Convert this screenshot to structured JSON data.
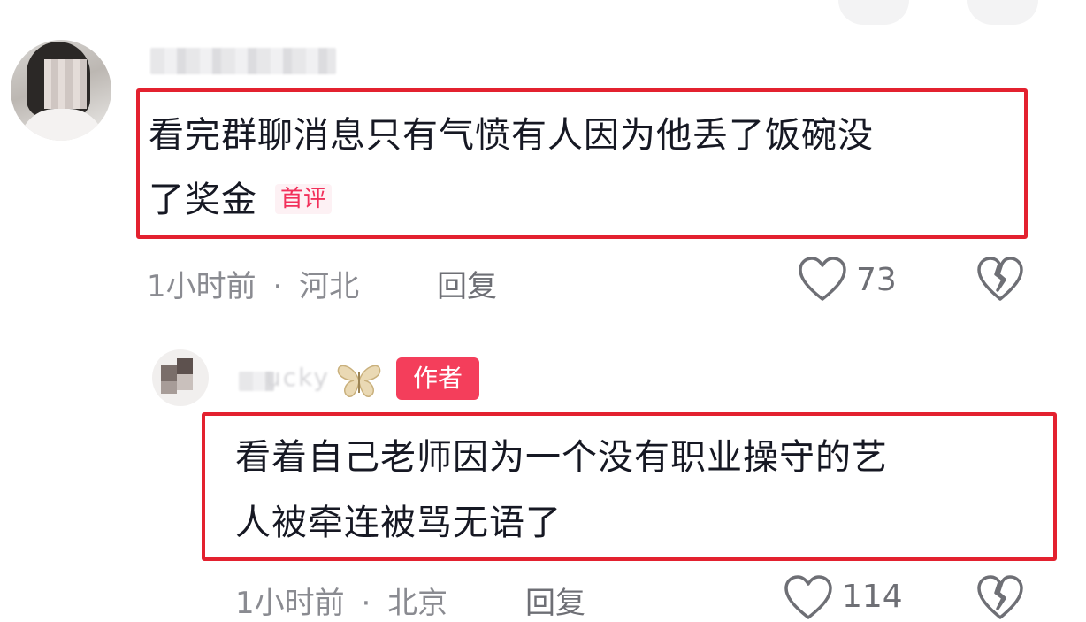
{
  "comments": [
    {
      "text_line1": "看完群聊消息只有气愤有人因为他丢了饭碗没",
      "text_line2": "了奖金",
      "tag": "首评",
      "time": "1小时前",
      "separator": "·",
      "location": "河北",
      "reply_label": "回复",
      "like_count": "73",
      "like_icon": "heart-outline-icon",
      "dislike_icon": "broken-heart-icon"
    },
    {
      "username_visible": "ucky",
      "name_icon": "butterfly-icon",
      "badge": "作者",
      "text_line1": "看着自己老师因为一个没有职业操守的艺",
      "text_line2": "人被牵连被骂无语了",
      "time": "1小时前",
      "separator": "·",
      "location": "北京",
      "reply_label": "回复",
      "like_count": "114",
      "like_icon": "heart-outline-icon",
      "dislike_icon": "broken-heart-icon"
    }
  ],
  "colors": {
    "highlight_box": "#e3212f",
    "author_badge": "#f43e5b",
    "first_comment_tag": "#f2305b",
    "meta_text": "#8a8b91"
  }
}
